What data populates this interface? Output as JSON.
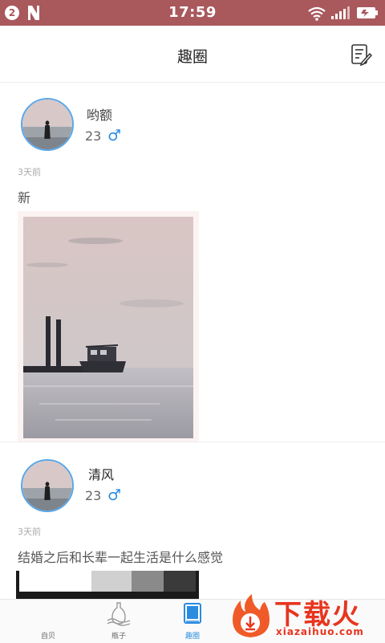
{
  "status_bar": {
    "notification_count": "2",
    "time": "17:59"
  },
  "header": {
    "title": "趣圈"
  },
  "posts": [
    {
      "username": "哟额",
      "age": "23",
      "gender_symbol": "♂",
      "time_ago": "3天前",
      "content": "新"
    },
    {
      "username": "清风",
      "age": "23",
      "gender_symbol": "♂",
      "time_ago": "3天前",
      "content": "结婚之后和长辈一起生活是什么感觉"
    }
  ],
  "tabs": [
    {
      "label": "自贝",
      "icon": "home-icon"
    },
    {
      "label": "瓶子",
      "icon": "bottle-icon"
    },
    {
      "label": "趣圈",
      "icon": "book-icon",
      "active": true
    }
  ],
  "watermark": {
    "main": "下载火",
    "sub": "xiazaihuo.com"
  },
  "colors": {
    "status_bar": "#a9585c",
    "accent_blue": "#2a8be0",
    "watermark_red": "#e8351e"
  }
}
